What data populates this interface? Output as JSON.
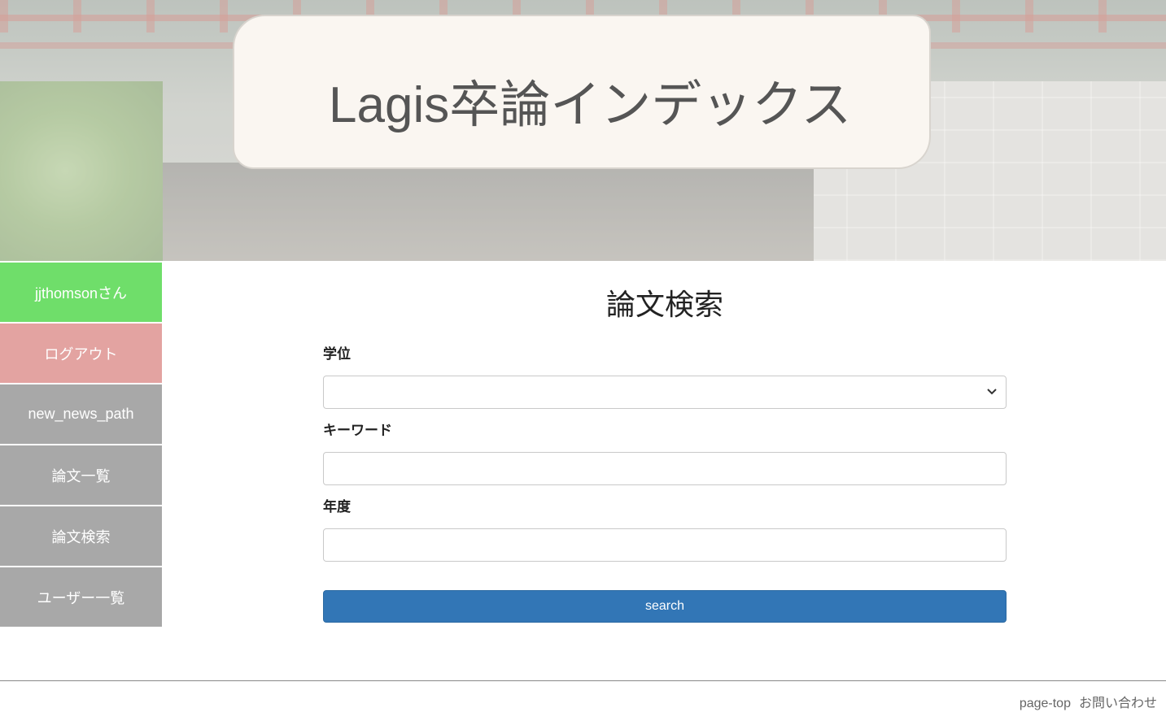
{
  "header": {
    "site_title": "Lagis卒論インデックス"
  },
  "sidebar": {
    "items": [
      {
        "label": "jjthomsonさん",
        "color": "#6fde6a"
      },
      {
        "label": "ログアウト",
        "color": "#e3a3a1"
      },
      {
        "label": "new_news_path",
        "color": "#a8a8a8"
      },
      {
        "label": "論文一覧",
        "color": "#a8a8a8"
      },
      {
        "label": "論文検索",
        "color": "#a8a8a8"
      },
      {
        "label": "ユーザー一覧",
        "color": "#a8a8a8"
      }
    ]
  },
  "main": {
    "page_title": "論文検索",
    "fields": {
      "degree_label": "学位",
      "degree_value": "",
      "keyword_label": "キーワード",
      "keyword_value": "",
      "year_label": "年度",
      "year_value": ""
    },
    "search_button": "search",
    "accent_color": "#3276b6"
  },
  "footer": {
    "page_top": "page-top",
    "contact": "お問い合わせ"
  }
}
